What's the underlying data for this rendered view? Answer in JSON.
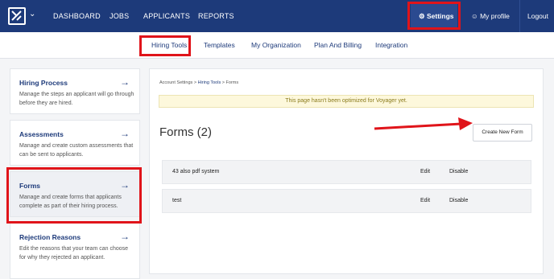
{
  "topnav": {
    "items": [
      "DASHBOARD",
      "JOBS",
      "APPLICANTS",
      "REPORTS"
    ],
    "settings_label": "Settings",
    "profile_label": "My profile",
    "logout_label": "Logout"
  },
  "subnav": {
    "items": [
      "Hiring Tools",
      "Templates",
      "My Organization",
      "Plan And Billing",
      "Integration"
    ]
  },
  "sidebar": {
    "cards": [
      {
        "title": "Hiring Process",
        "desc": "Manage the steps an applicant will go through before they are hired."
      },
      {
        "title": "Assessments",
        "desc": "Manage and create custom assessments that can be sent to applicants."
      },
      {
        "title": "Forms",
        "desc": "Manage and create forms that applicants complete as part of their hiring process."
      },
      {
        "title": "Rejection Reasons",
        "desc": "Edit the reasons that your team can choose for why they rejected an applicant."
      }
    ]
  },
  "main": {
    "breadcrumb": {
      "part1": "Account Settings",
      "sep": ">",
      "part2": "Hiring Tools",
      "part3": "Forms"
    },
    "banner": "This page hasn't been optimized for Voyager yet.",
    "title": "Forms (2)",
    "create_button": "Create New Form",
    "rows": [
      {
        "name": "43 also pdf system",
        "edit": "Edit",
        "disable": "Disable"
      },
      {
        "name": "test",
        "edit": "Edit",
        "disable": "Disable"
      }
    ]
  },
  "colors": {
    "brand": "#1d3a7a",
    "highlight": "#e0141a",
    "banner": "#fdf8dc"
  }
}
